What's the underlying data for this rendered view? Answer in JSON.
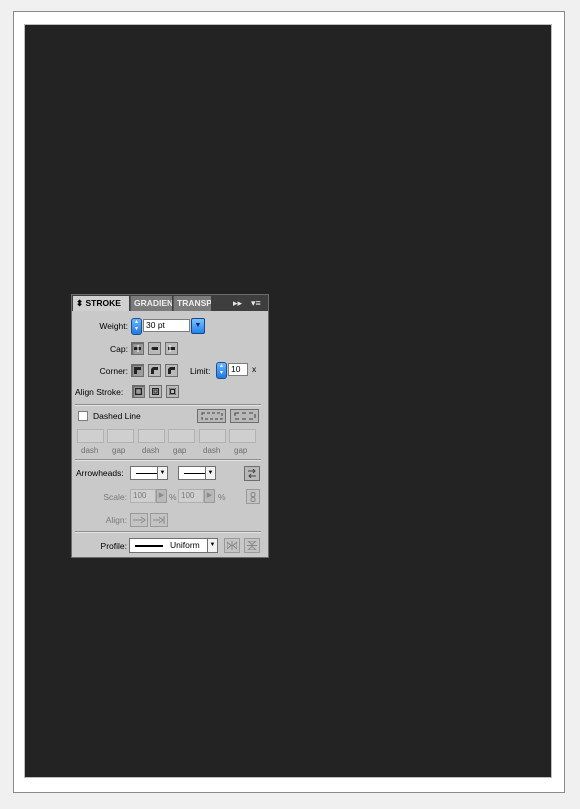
{
  "panel": {
    "tabs": [
      {
        "label": "STROKE",
        "active": true
      },
      {
        "label": "GRADIENT",
        "active": false
      },
      {
        "label": "TRANSP",
        "active": false
      }
    ],
    "tab_controls": {
      "collapse": "▸▸",
      "menu": "▾≡"
    },
    "weight_label": "Weight:",
    "weight_value": "30 pt",
    "cap_label": "Cap:",
    "corner_label": "Corner:",
    "limit_label": "Limit:",
    "limit_value": "10",
    "limit_unit": "x",
    "align_stroke_label": "Align Stroke:",
    "dashed_line_label": "Dashed Line",
    "dashed_line_checked": false,
    "dash_labels": [
      "dash",
      "gap",
      "dash",
      "gap",
      "dash",
      "gap"
    ],
    "arrowheads_label": "Arrowheads:",
    "scale_label": "Scale:",
    "scale_start": "100",
    "scale_end": "100",
    "percent": "%",
    "align_label": "Align:",
    "profile_label": "Profile:",
    "profile_value": "Uniform"
  },
  "colors": {
    "canvas": "#232323",
    "panel_bg": "#c9c9c9",
    "accent_blue": "#2383eb"
  }
}
